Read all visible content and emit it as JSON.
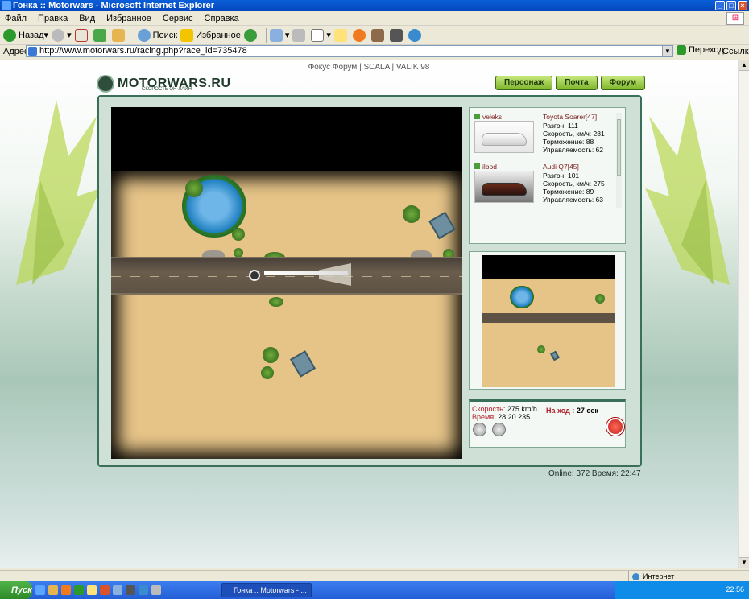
{
  "window": {
    "title": "Гонка :: Motorwars - Microsoft Internet Explorer"
  },
  "menu": [
    "Файл",
    "Правка",
    "Вид",
    "Избранное",
    "Сервис",
    "Справка"
  ],
  "toolbar": {
    "back": "Назад",
    "search": "Поиск",
    "favorites": "Избранное"
  },
  "address": {
    "label": "Адрес:",
    "url": "http://www.motorwars.ru/racing.php?race_id=735478",
    "go": "Переход",
    "links": "Ссылки"
  },
  "site": {
    "toplinks": "Фокус Форум | SCALA | VALIK 98",
    "logo": "MOTORWARS.RU",
    "logo_sub": "СКОРОСТЬ ОН-ЛАЙН",
    "nav": [
      "Персонаж",
      "Почта",
      "Форум"
    ]
  },
  "players": [
    {
      "name": "veleks",
      "model": "Toyota Soarer[47]",
      "stats": [
        "Разгон: 111",
        "Скорость, км/ч: 281",
        "Торможение: 88",
        "Управляемость: 62"
      ]
    },
    {
      "name": "ilbod",
      "model": "Audi Q7[45]",
      "stats": [
        "Разгон: 101",
        "Скорость, км/ч: 275",
        "Торможение: 89",
        "Управляемость: 63"
      ]
    }
  ],
  "status": {
    "speed_label": "Скорость:",
    "speed": "275 km/h",
    "time_label": "Время:",
    "time": "28:20.235",
    "turn_label": "На ход :",
    "turn": "27 сек"
  },
  "footer": {
    "online": "Online: 372  Время: 22:47"
  },
  "statusbar": {
    "zone": "Интернет"
  },
  "taskbar": {
    "start": "Пуск",
    "task": "Гонка :: Motorwars - ...",
    "clock": "22:56"
  },
  "colors": {
    "accent": "#3a6f59",
    "button": "#7fb52c",
    "sand": "#e6c488"
  }
}
